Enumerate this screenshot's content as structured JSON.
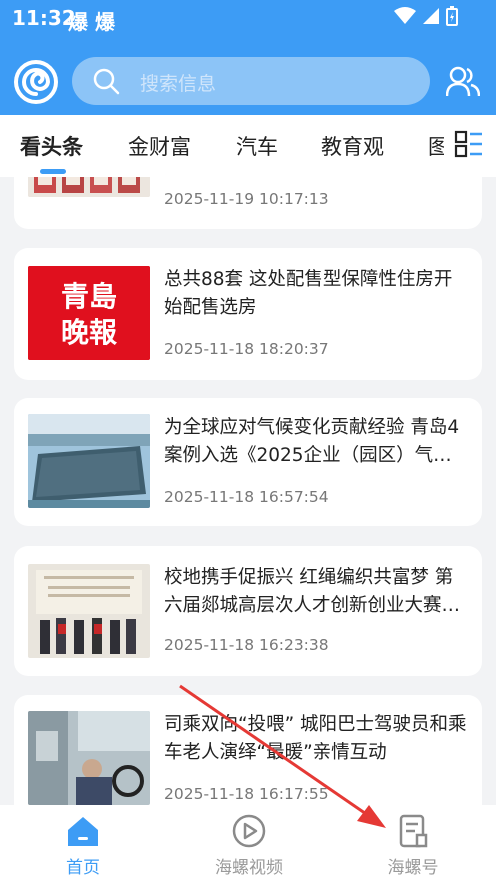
{
  "status": {
    "time": "11:32",
    "notif_icons": "爆 爆"
  },
  "search": {
    "placeholder": "搜索信息"
  },
  "tabs": [
    "看头条",
    "金财富",
    "汽车",
    "教育观",
    "图"
  ],
  "articles": [
    {
      "title": "",
      "time": "2025-11-19 10:17:13"
    },
    {
      "title": "总共88套 这处配售型保障性住房开始配售选房",
      "time": "2025-11-18 18:20:37",
      "thumb_text": "青岛\n晚報"
    },
    {
      "title": "为全球应对气候变化贡献经验 青岛4案例入选《2025企业（园区）气…",
      "time": "2025-11-18 16:57:54"
    },
    {
      "title": "校地携手促振兴 红绳编织共富梦 第六届郯城高层次人才创新创业大赛…",
      "time": "2025-11-18 16:23:38"
    },
    {
      "title": "司乘双向“投喂” 城阳巴士驾驶员和乘车老人演绎“最暖”亲情互动",
      "time": "2025-11-18 16:17:55"
    }
  ],
  "bottom_nav": [
    {
      "label": "首页",
      "icon": "home-icon"
    },
    {
      "label": "海螺视频",
      "icon": "video-icon"
    },
    {
      "label": "海螺号",
      "icon": "document-icon"
    }
  ],
  "colors": {
    "primary": "#3d9cf5",
    "annotation": "#e53935"
  }
}
